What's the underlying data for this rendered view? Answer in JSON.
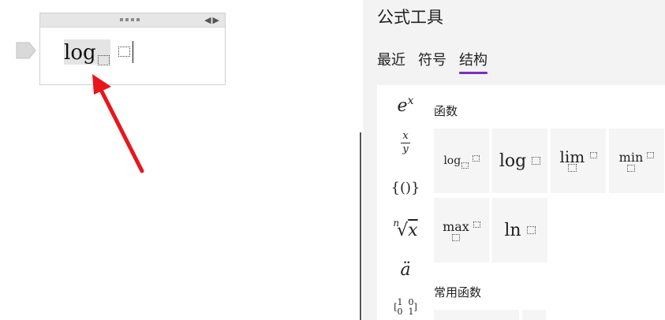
{
  "equation": {
    "function_label": "log"
  },
  "panel": {
    "title": "公式工具",
    "tabs": [
      {
        "label": "最近"
      },
      {
        "label": "符号"
      },
      {
        "label": "结构",
        "active": true
      }
    ],
    "active_tab_underline_color": "#7b2fbe",
    "categories": [
      {
        "name": "exponent-icon",
        "base": "e",
        "sup": "x"
      },
      {
        "name": "fraction-icon",
        "num": "x",
        "den": "y"
      },
      {
        "name": "bracket-icon",
        "label": "{()}"
      },
      {
        "name": "radical-icon",
        "index": "n",
        "radicand": "x"
      },
      {
        "name": "accent-icon",
        "label": "ä"
      },
      {
        "name": "matrix-icon",
        "row1": "1  0",
        "row2": "0  1"
      }
    ],
    "sections": [
      {
        "title": "函数",
        "items": [
          {
            "name": "log-base-button",
            "label": "log"
          },
          {
            "name": "log-button",
            "label": "log"
          },
          {
            "name": "lim-button",
            "label": "lim"
          },
          {
            "name": "min-button",
            "label": "min"
          },
          {
            "name": "max-button",
            "label": "max"
          },
          {
            "name": "ln-button",
            "label": "ln"
          }
        ]
      },
      {
        "title": "常用函数"
      }
    ]
  },
  "colors": {
    "arrow": "#e8161b",
    "panel_bg": "#f3f3f3",
    "button_bg": "#f5f5f5"
  }
}
